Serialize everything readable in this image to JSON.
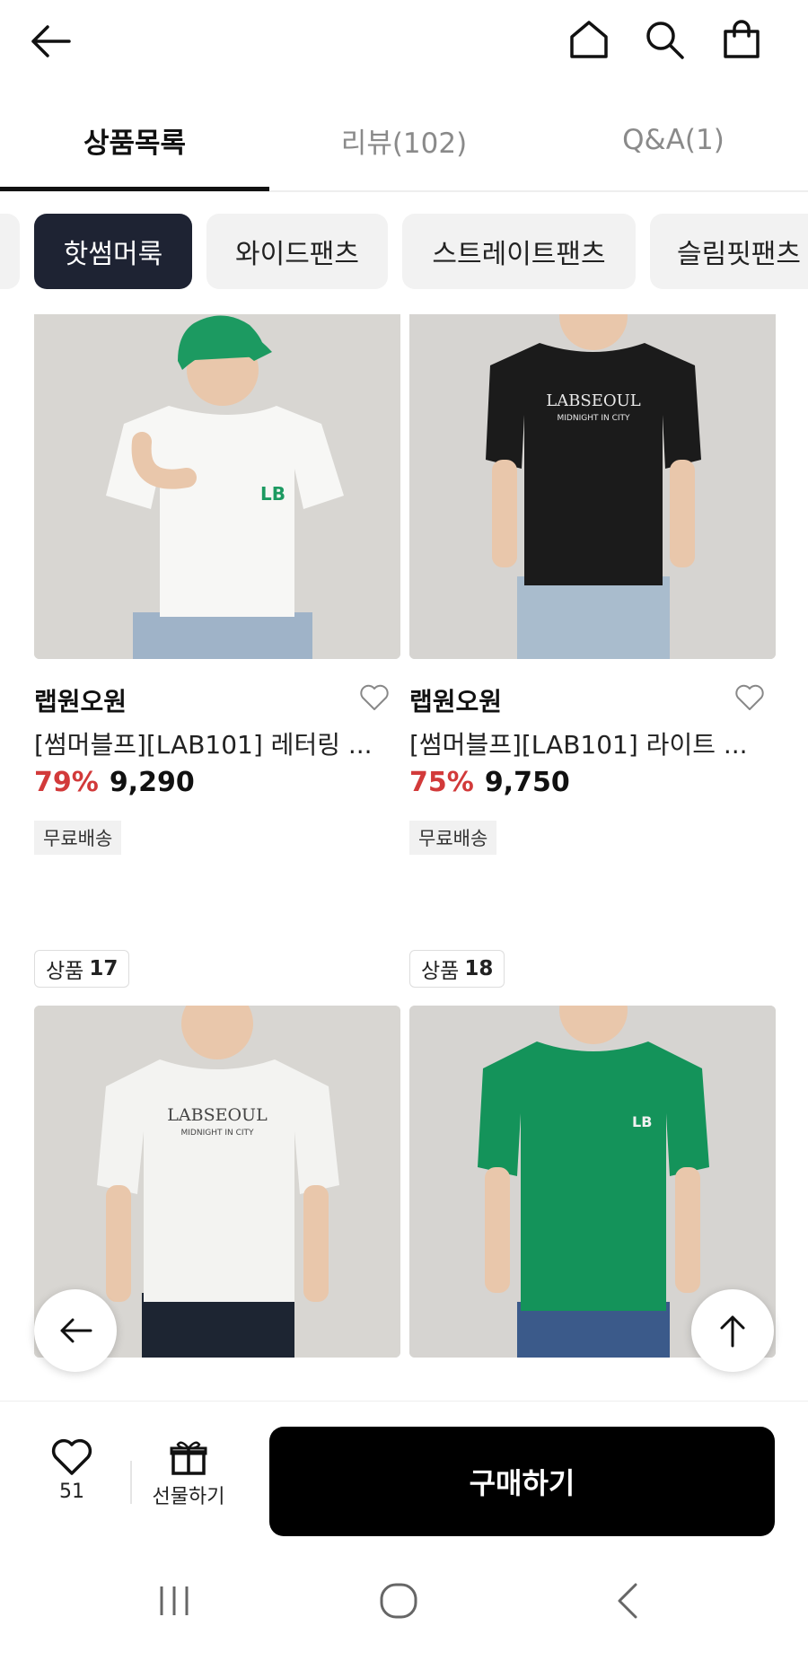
{
  "header": {
    "back_icon": "arrow-left-icon",
    "home_icon": "home-icon",
    "search_icon": "search-icon",
    "bag_icon": "shopping-bag-icon"
  },
  "tabs": [
    {
      "label": "상품목록",
      "active": true
    },
    {
      "label": "리뷰(102)",
      "active": false
    },
    {
      "label": "Q&A(1)",
      "active": false
    }
  ],
  "chips": [
    {
      "label": "핫썸머룩",
      "active": true
    },
    {
      "label": "와이드팬츠",
      "active": false
    },
    {
      "label": "스트레이트팬츠",
      "active": false
    },
    {
      "label": "슬림핏팬츠",
      "active": false
    }
  ],
  "products": [
    {
      "brand": "랩원오원",
      "name": "[썸머블프][LAB101] 레터링 ...",
      "discount": "79%",
      "price": "9,290",
      "badge": "무료배송",
      "shirt_color": "#f7f7f5"
    },
    {
      "brand": "랩원오원",
      "name": "[썸머블프][LAB101] 라이트 ...",
      "discount": "75%",
      "price": "9,750",
      "badge": "무료배송",
      "shirt_color": "#1b1b1b"
    },
    {
      "count_label": "상품",
      "count": "17",
      "shirt_color": "#f3f3f1"
    },
    {
      "count_label": "상품",
      "count": "18",
      "shirt_color": "#14935a"
    }
  ],
  "bottom_bar": {
    "like_count": "51",
    "gift_label": "선물하기",
    "buy_label": "구매하기"
  },
  "colors": {
    "discount": "#d23a3a",
    "chip_active_bg": "#1e2333",
    "buy_bg": "#000000"
  }
}
